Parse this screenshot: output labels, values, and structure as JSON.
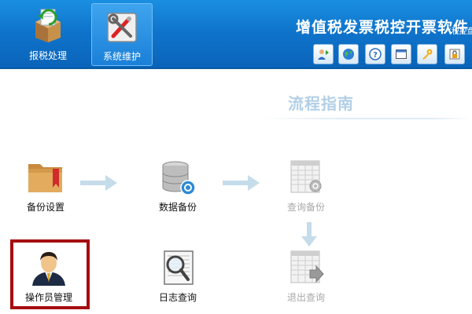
{
  "nav": {
    "report_label": "报税处理",
    "system_label": "系统维护"
  },
  "header": {
    "title": "增值税发票税控开票软件",
    "subtitle": "(税控盘"
  },
  "toolbar": {
    "icons": [
      "user-switch-icon",
      "globe-icon",
      "help-icon",
      "window-icon",
      "key-icon",
      "lock-icon"
    ]
  },
  "guide": {
    "title": "流程指南",
    "items": {
      "backup_settings": "备份设置",
      "data_backup": "数据备份",
      "query_backup": "查询备份",
      "operator_management": "操作员管理",
      "log_query": "日志查询",
      "exit_query": "退出查询"
    }
  },
  "colors": {
    "header_blue": "#0f74cc",
    "highlight_red": "#a60d10",
    "guide_title": "#b2cfe6",
    "disabled_text": "#a9a9a9"
  }
}
